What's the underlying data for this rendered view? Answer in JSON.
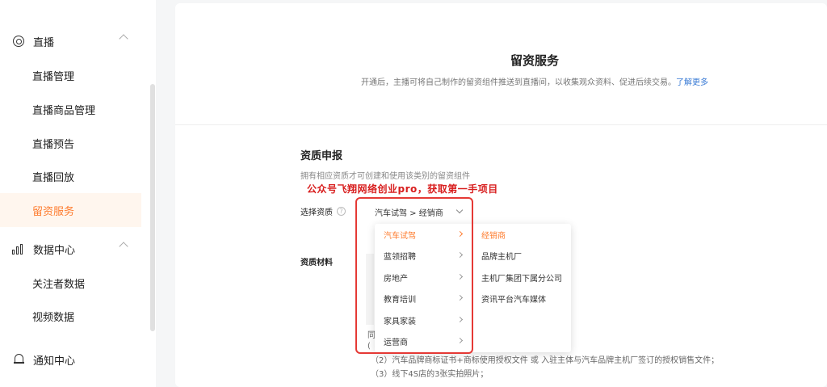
{
  "sidebar": {
    "groups": [
      {
        "label": "直播",
        "icon": "live-circle-icon"
      },
      {
        "label": "数据中心",
        "icon": "bar-chart-icon"
      },
      {
        "label": "通知中心",
        "icon": "bell-icon"
      }
    ],
    "live_items": [
      "直播管理",
      "直播商品管理",
      "直播预告",
      "直播回放",
      "留资服务"
    ],
    "data_items": [
      "关注者数据",
      "视频数据"
    ],
    "active_item": "留资服务"
  },
  "header": {
    "title": "留资服务",
    "description": "开通后，主播可将自己制作的留资组件推送到直播间，以收集观众资料、促进后续交易。",
    "learn_more": "了解更多"
  },
  "qualification": {
    "title": "资质申报",
    "description": "拥有相应资质才可创建和使用该类别的留资组件",
    "select_label": "选择资质",
    "selected_value": "汽车试驾 > 经销商",
    "materials_label": "资质材料",
    "agree_fragment_1": "同",
    "agree_fragment_2": "(",
    "notes": [
      "（2）汽车品牌商标证书+商标使用授权文件 或 入驻主体与汽车品牌主机厂签订的授权销售文件；",
      "（3）线下4S店的3张实拍照片；"
    ]
  },
  "watermark": "公众号飞翔网络创业pro，获取第一手项目",
  "cascader": {
    "categories": [
      "汽车试驾",
      "蓝领招聘",
      "房地产",
      "教育培训",
      "家具家装",
      "运营商"
    ],
    "selected_category": "汽车试驾",
    "sub_options": [
      "经销商",
      "品牌主机厂",
      "主机厂集团下属分公司",
      "资讯平台汽车媒体"
    ],
    "selected_sub": "经销商"
  },
  "colors": {
    "accent": "#fe7c2f",
    "annotation": "#e53935",
    "link": "#3a7bd5"
  }
}
